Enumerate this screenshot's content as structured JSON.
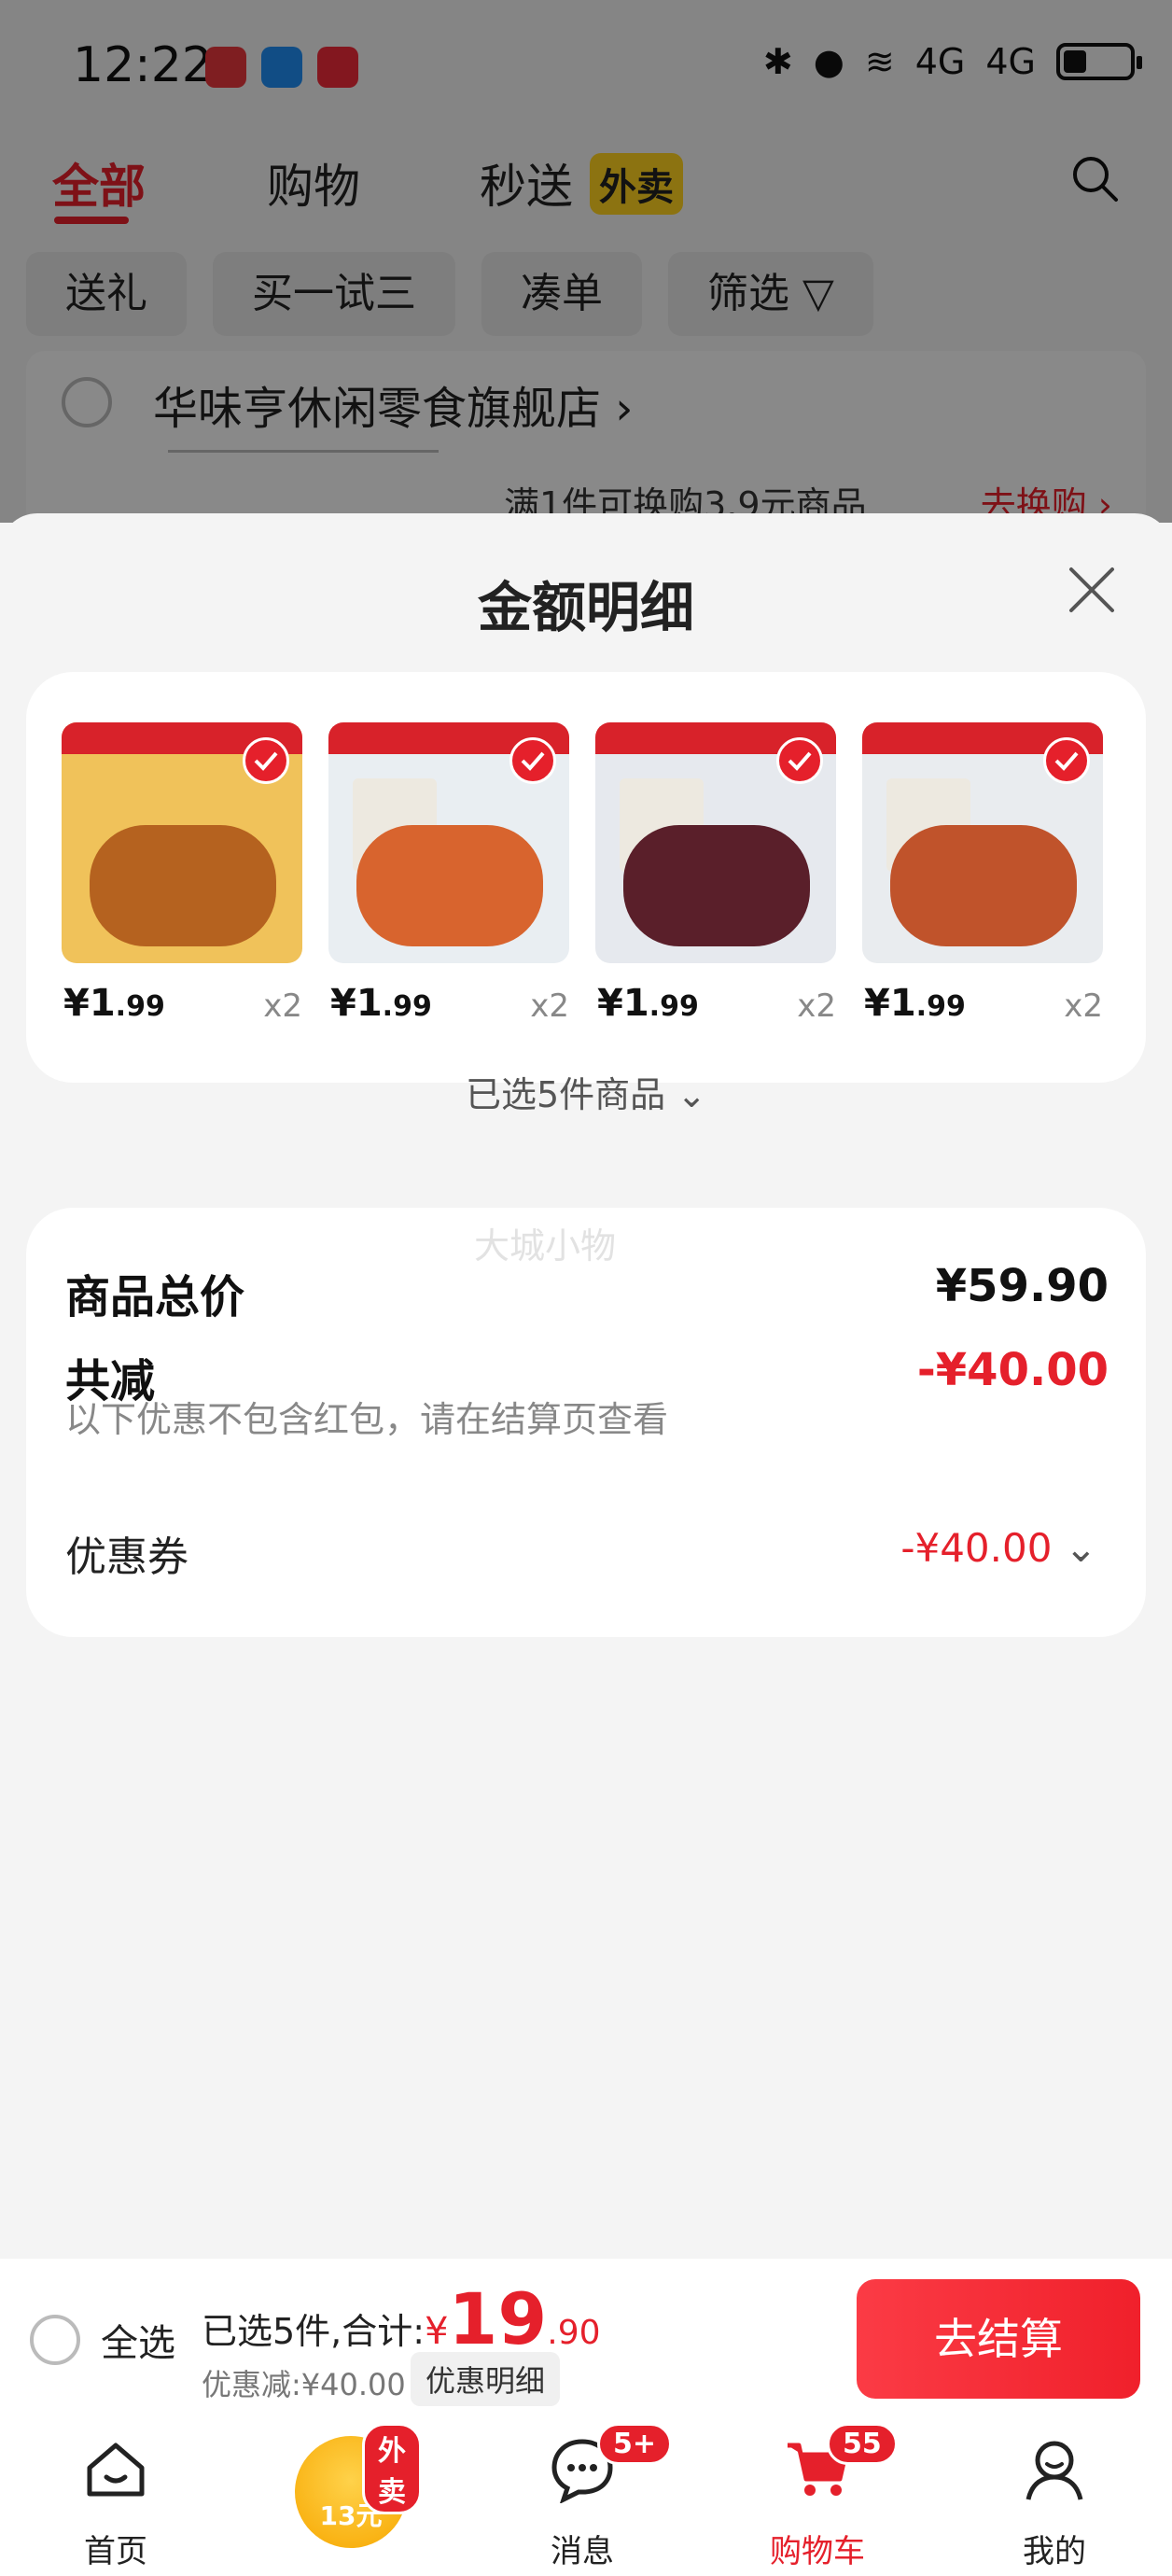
{
  "status": {
    "time": "12:22",
    "signal_a": "4G",
    "signal_b": "4G"
  },
  "tabs": [
    {
      "label": "全部"
    },
    {
      "label": "购物"
    },
    {
      "label": "秒送",
      "tag": "外卖"
    }
  ],
  "chips": [
    "送礼",
    "买一试三",
    "凑单",
    "筛选"
  ],
  "store": {
    "name": "华味亨休闲零食旗舰店",
    "swap_text": "满1件可换购3.9元商品",
    "swap_link": "去换购"
  },
  "sheet": {
    "title": "金额明细",
    "items": [
      {
        "price_int": "¥1",
        "price_dec": ".99",
        "qty": "x2",
        "color": "#b5621f",
        "bg": "#f0c25a"
      },
      {
        "price_int": "¥1",
        "price_dec": ".99",
        "qty": "x2",
        "color": "#d8642e",
        "bg": "#e9eef2"
      },
      {
        "price_int": "¥1",
        "price_dec": ".99",
        "qty": "x2",
        "color": "#5a1f2a",
        "bg": "#e6e9ee"
      },
      {
        "price_int": "¥1",
        "price_dec": ".99",
        "qty": "x2",
        "color": "#c0532b",
        "bg": "#e9ecef"
      }
    ],
    "selected_info": "已选5件商品",
    "watermark": "大城小物",
    "summary": {
      "total_label": "商品总价",
      "total_value": "¥59.90",
      "reduce_label": "共减",
      "reduce_value": "-¥40.00",
      "reduce_note": "以下优惠不包含红包，请在结算页查看",
      "coupon_label": "优惠券",
      "coupon_value": "-¥40.00"
    }
  },
  "checkout": {
    "select_all": "全选",
    "selected_prefix": "已选5件,合计:",
    "yen": "¥",
    "total_int": "19",
    "total_dec": ".90",
    "discount": "优惠减:¥40.00",
    "detail_button": "优惠明细",
    "checkout_button": "去结算"
  },
  "nav": {
    "home": "首页",
    "waimai_badge": "外卖",
    "waimai_amount": "13元",
    "messages": "消息",
    "messages_badge": "5+",
    "cart": "购物车",
    "cart_badge": "55",
    "mine": "我的"
  },
  "colors": {
    "accent": "#e5202b",
    "tag_yellow": "#ffd21f"
  }
}
